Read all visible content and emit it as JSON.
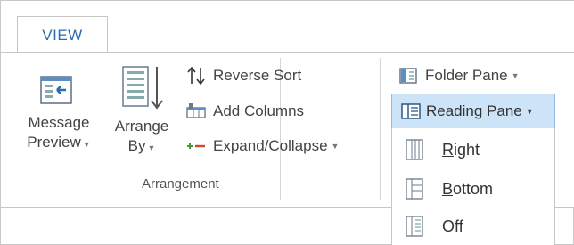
{
  "tabs": {
    "active": "VIEW"
  },
  "arrangement": {
    "group_label": "Arrangement",
    "message_preview": {
      "line1": "Message",
      "line2": "Preview"
    },
    "arrange_by": {
      "line1": "Arrange",
      "line2": "By"
    },
    "reverse_sort": "Reverse Sort",
    "add_columns": "Add Columns",
    "expand_collapse": "Expand/Collapse"
  },
  "layout": {
    "folder_pane": "Folder Pane",
    "reading_pane": "Reading Pane",
    "menu": [
      {
        "accel": "R",
        "rest": "ight"
      },
      {
        "accel": "B",
        "rest": "ottom"
      },
      {
        "accel": "O",
        "rest": "ff"
      }
    ]
  },
  "colors": {
    "accent": "#2b6cb0",
    "highlight": "#cde3f7",
    "expand_red": "#d04a2a",
    "expand_green": "#4a9a3a"
  },
  "icons": [
    "message-preview-icon",
    "arrange-by-icon",
    "reverse-sort-icon",
    "add-columns-icon",
    "expand-collapse-icon",
    "folder-pane-icon",
    "reading-pane-icon",
    "reading-pane-right-icon",
    "reading-pane-bottom-icon",
    "reading-pane-off-icon"
  ]
}
